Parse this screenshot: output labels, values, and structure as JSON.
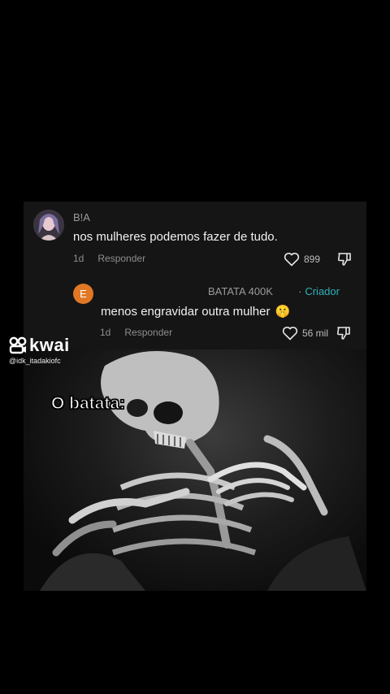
{
  "comment1": {
    "author": "B!A",
    "text": "nos mulheres podemos fazer de tudo.",
    "time": "1d",
    "reply_label": "Responder",
    "likes": "899",
    "avatar_icon": "user-photo-avatar"
  },
  "comment2": {
    "avatar_letter": "E",
    "avatar_color": "#e07825",
    "author": "BATATA 400K",
    "badge": "Criador",
    "badge_color": "#2fb2bd",
    "text": "menos engravidar outra mulher",
    "emoji": "🤫",
    "time": "1d",
    "reply_label": "Responder",
    "likes": "56 mil"
  },
  "watermark": {
    "brand": "kwai",
    "handle": "@idk_itadakiofc",
    "logo_icon": "kwai-logo-icon"
  },
  "meme": {
    "caption": "O batata:",
    "image": "skeleton-image"
  }
}
